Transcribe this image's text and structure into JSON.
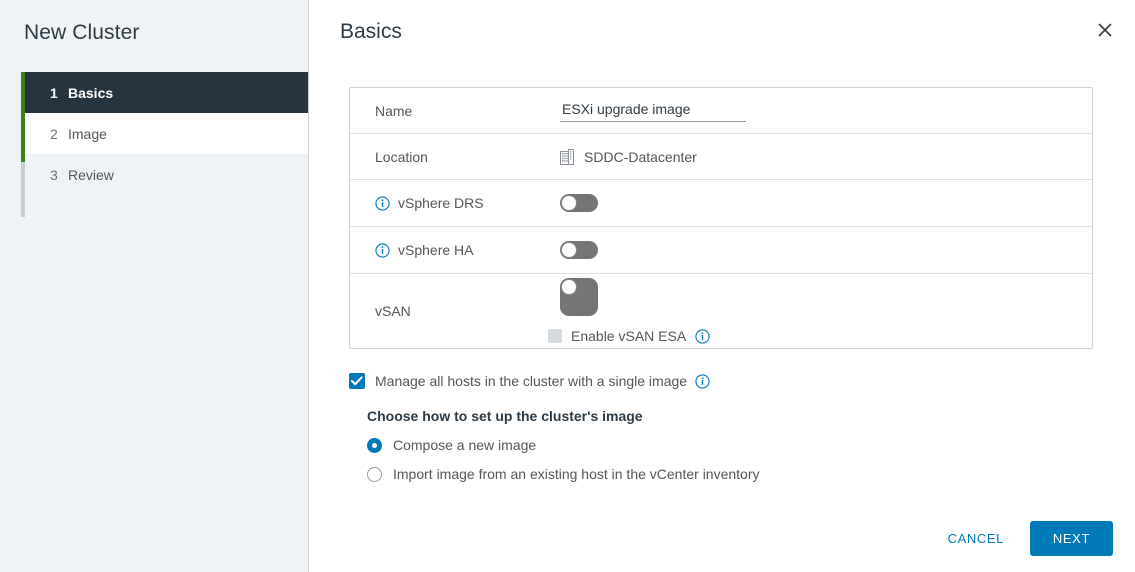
{
  "sidebar": {
    "title": "New Cluster",
    "steps": [
      {
        "num": "1",
        "label": "Basics"
      },
      {
        "num": "2",
        "label": "Image"
      },
      {
        "num": "3",
        "label": "Review"
      }
    ]
  },
  "header": {
    "title": "Basics",
    "close_icon": "close-icon"
  },
  "form": {
    "name": {
      "label": "Name",
      "value": "ESXi upgrade image",
      "placeholder": ""
    },
    "location": {
      "label": "Location",
      "value": "SDDC-Datacenter",
      "icon": "datacenter-building-icon"
    },
    "drs": {
      "label": "vSphere DRS",
      "info_icon": "info-icon",
      "toggle_state": "off"
    },
    "ha": {
      "label": "vSphere HA",
      "info_icon": "info-icon",
      "toggle_state": "off"
    },
    "vsan": {
      "label": "vSAN",
      "toggle_state": "off",
      "esa_label": "Enable vSAN ESA",
      "esa_checked": "false",
      "esa_info_icon": "info-icon"
    }
  },
  "image_section": {
    "manage_label": "Manage all hosts in the cluster with a single image",
    "manage_checked": "true",
    "manage_info_icon": "info-icon",
    "choose_label": "Choose how to set up the cluster's image",
    "options": [
      {
        "label": "Compose a new image",
        "selected": "true"
      },
      {
        "label": "Import image from an existing host in the vCenter inventory",
        "selected": "false"
      }
    ]
  },
  "footer": {
    "cancel_label": "CANCEL",
    "next_label": "NEXT"
  },
  "colors": {
    "accent": "#0079b8",
    "active_step_bg": "#26343f",
    "progress_green": "#3c841a",
    "sidebar_bg": "#eff3f5",
    "toggle_off": "#757575"
  }
}
